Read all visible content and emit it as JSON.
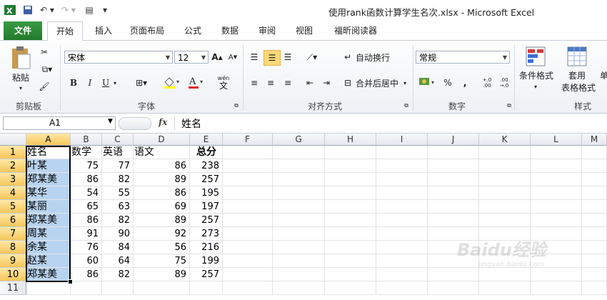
{
  "window": {
    "title": "使用rank函数计算学生名次.xlsx  -  Microsoft Excel"
  },
  "tabs": [
    "文件",
    "开始",
    "插入",
    "页面布局",
    "公式",
    "数据",
    "审阅",
    "视图",
    "福昕阅读器"
  ],
  "ribbon": {
    "clipboard": {
      "paste": "粘贴",
      "label": "剪贴板"
    },
    "font": {
      "name": "宋体",
      "size": "12",
      "label": "字体",
      "bold": "B",
      "italic": "I",
      "underline": "U",
      "wen": "wén",
      "wen2": "文"
    },
    "align": {
      "wrap": "自动换行",
      "merge": "合并后居中",
      "label": "对齐方式"
    },
    "number": {
      "format": "常规",
      "percent": "%",
      "comma": ",",
      "inc": "+.0 .00",
      "dec": ".00 →.0",
      "label": "数字"
    },
    "styles": {
      "cond": "条件格式",
      "table1": "套用",
      "table2": "表格格式",
      "cell": "单",
      "label": "样式"
    }
  },
  "formula_bar": {
    "name_box": "A1",
    "fx": "fx",
    "content": "姓名"
  },
  "columns": [
    "A",
    "B",
    "C",
    "D",
    "E",
    "F",
    "G",
    "H",
    "I",
    "J",
    "K",
    "L",
    "M"
  ],
  "rows": [
    "1",
    "2",
    "3",
    "4",
    "5",
    "6",
    "7",
    "8",
    "9",
    "10",
    "11"
  ],
  "headers": [
    "姓名",
    "数学",
    "英语",
    "语文",
    "总分"
  ],
  "students": [
    {
      "name": "叶某",
      "math": "75",
      "english": "77",
      "chinese": "86",
      "total": "238"
    },
    {
      "name": "郑某美",
      "math": "86",
      "english": "82",
      "chinese": "89",
      "total": "257"
    },
    {
      "name": "某华",
      "math": "54",
      "english": "55",
      "chinese": "86",
      "total": "195"
    },
    {
      "name": "某丽",
      "math": "65",
      "english": "63",
      "chinese": "69",
      "total": "197"
    },
    {
      "name": "郑某美",
      "math": "86",
      "english": "82",
      "chinese": "89",
      "total": "257"
    },
    {
      "name": "周某",
      "math": "91",
      "english": "90",
      "chinese": "92",
      "total": "273"
    },
    {
      "name": "余某",
      "math": "76",
      "english": "84",
      "chinese": "56",
      "total": "216"
    },
    {
      "name": "赵某",
      "math": "60",
      "english": "64",
      "chinese": "75",
      "total": "199"
    },
    {
      "name": "郑某美",
      "math": "86",
      "english": "82",
      "chinese": "89",
      "total": "257"
    }
  ],
  "watermark": {
    "text": "Baidu经验",
    "sub": "jingyan.baidu.com"
  },
  "colors": {
    "file_tab": "#2a8a34",
    "selection": "#b8d3ef",
    "selected_header": "#f6c65b"
  }
}
